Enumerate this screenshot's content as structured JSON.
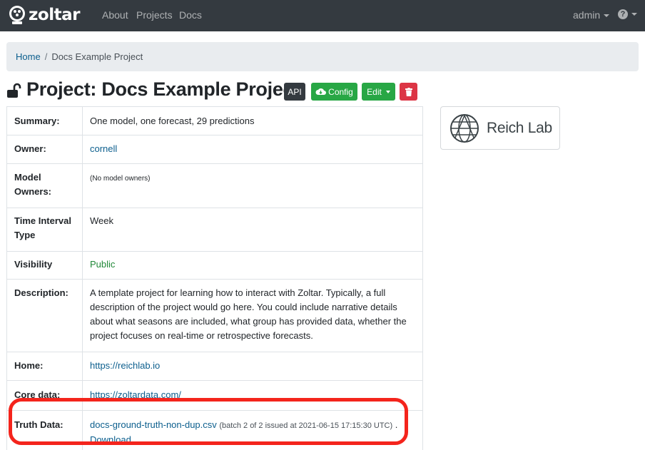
{
  "navbar": {
    "brand": "zoltar",
    "links": [
      "About",
      "Projects",
      "Docs"
    ],
    "user": "admin",
    "help_glyph": "?"
  },
  "breadcrumb": {
    "home": "Home",
    "separator": "/",
    "current": "Docs Example Project"
  },
  "title": "Project: Docs Example Project",
  "buttons": {
    "api": "API",
    "config": "Config",
    "edit": "Edit"
  },
  "details": {
    "summary_label": "Summary:",
    "summary_value": "One model, one forecast, 29 predictions",
    "owner_label": "Owner:",
    "owner_value": "cornell",
    "model_owners_label": "Model Owners:",
    "model_owners_value": "(No model owners)",
    "time_interval_label": "Time Interval Type",
    "time_interval_value": "Week",
    "visibility_label": "Visibility",
    "visibility_value": "Public",
    "description_label": "Description:",
    "description_value": "A template project for learning how to interact with Zoltar. Typically, a full description of the project would go here. You could include narrative details about what seasons are included, what group has provided data, whether the project focuses on real-time or retrospective forecasts.",
    "home_label": "Home:",
    "home_value": "https://reichlab.io",
    "core_data_label": "Core data:",
    "core_data_value": "https://zoltardata.com/",
    "truth_label": "Truth Data:",
    "truth_file": "docs-ground-truth-non-dup.csv",
    "truth_batch": "(batch 2 of 2 issued at 2021-06-15 17:15:30 UTC)",
    "truth_sep": ".",
    "truth_download": "Download"
  },
  "logo": {
    "text": "Reich Lab"
  },
  "colors": {
    "navbar": "#343a40",
    "link": "#0b5e8d",
    "success": "#28a745",
    "danger": "#dc3545",
    "highlight": "#f4241c"
  }
}
